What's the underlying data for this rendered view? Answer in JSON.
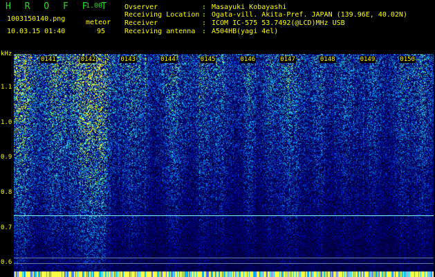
{
  "header": {
    "app_name": "H R O F F T",
    "version": "1.00",
    "filename": "1003150140.png",
    "datetime": "10.03.15 01:40",
    "mode_label": "meteor",
    "count": "95",
    "info": [
      {
        "key": "Ovserver",
        "sep": ":",
        "value": "Masayuki Kobayashi"
      },
      {
        "key": "Receiving Location",
        "sep": ":",
        "value": "Ogata-vill. Akita-Pref. JAPAN (139.96E, 40.02N)"
      },
      {
        "key": "Receiver",
        "sep": ":",
        "value": "ICOM IC-575 53.7492(@LCD)MHz USB"
      },
      {
        "key": "Receiving antenna",
        "sep": ":",
        "value": "A504HB(yagi 4el)"
      }
    ]
  },
  "chart_data": {
    "type": "heatmap",
    "ylabel": "kHz",
    "y_ticks": [
      "1.1",
      "1.0",
      "0.9",
      "0.8",
      "0.7",
      "0.6"
    ],
    "y_tick_values": [
      1.1,
      1.0,
      0.9,
      0.8,
      0.7,
      0.6
    ],
    "ylim": [
      0.575,
      1.195
    ],
    "x_ticks": [
      "0141",
      "0142",
      "0143",
      "0144",
      "0145",
      "0146",
      "0147",
      "0148",
      "0149",
      "0150"
    ],
    "carrier_lines_khz": [
      0.735,
      0.615,
      0.598
    ],
    "colors": {
      "background": "#000010",
      "signal_low": "#0000a0",
      "signal_mid": "#00c0ff",
      "signal_high": "#ffff40",
      "carrier": "#80ffff",
      "text": "#ffff00",
      "logo": "#22dd22"
    }
  }
}
